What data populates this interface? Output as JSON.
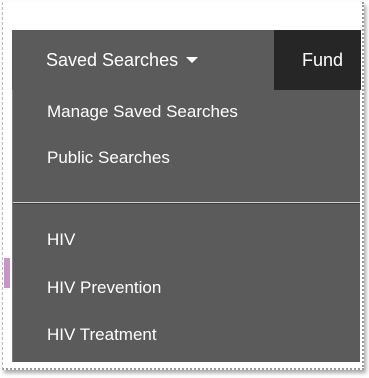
{
  "nav": {
    "saved_searches_label": "Saved Searches",
    "next_item_label": "Fund"
  },
  "menu": {
    "items": [
      {
        "label": "Manage Saved Searches"
      },
      {
        "label": "Public Searches"
      },
      {
        "label": "HIV"
      },
      {
        "label": "HIV Prevention"
      },
      {
        "label": "HIV Treatment"
      }
    ]
  },
  "colors": {
    "navbar": "#262626",
    "menu_background": "#5b5b5b",
    "text": "#ffffff"
  }
}
